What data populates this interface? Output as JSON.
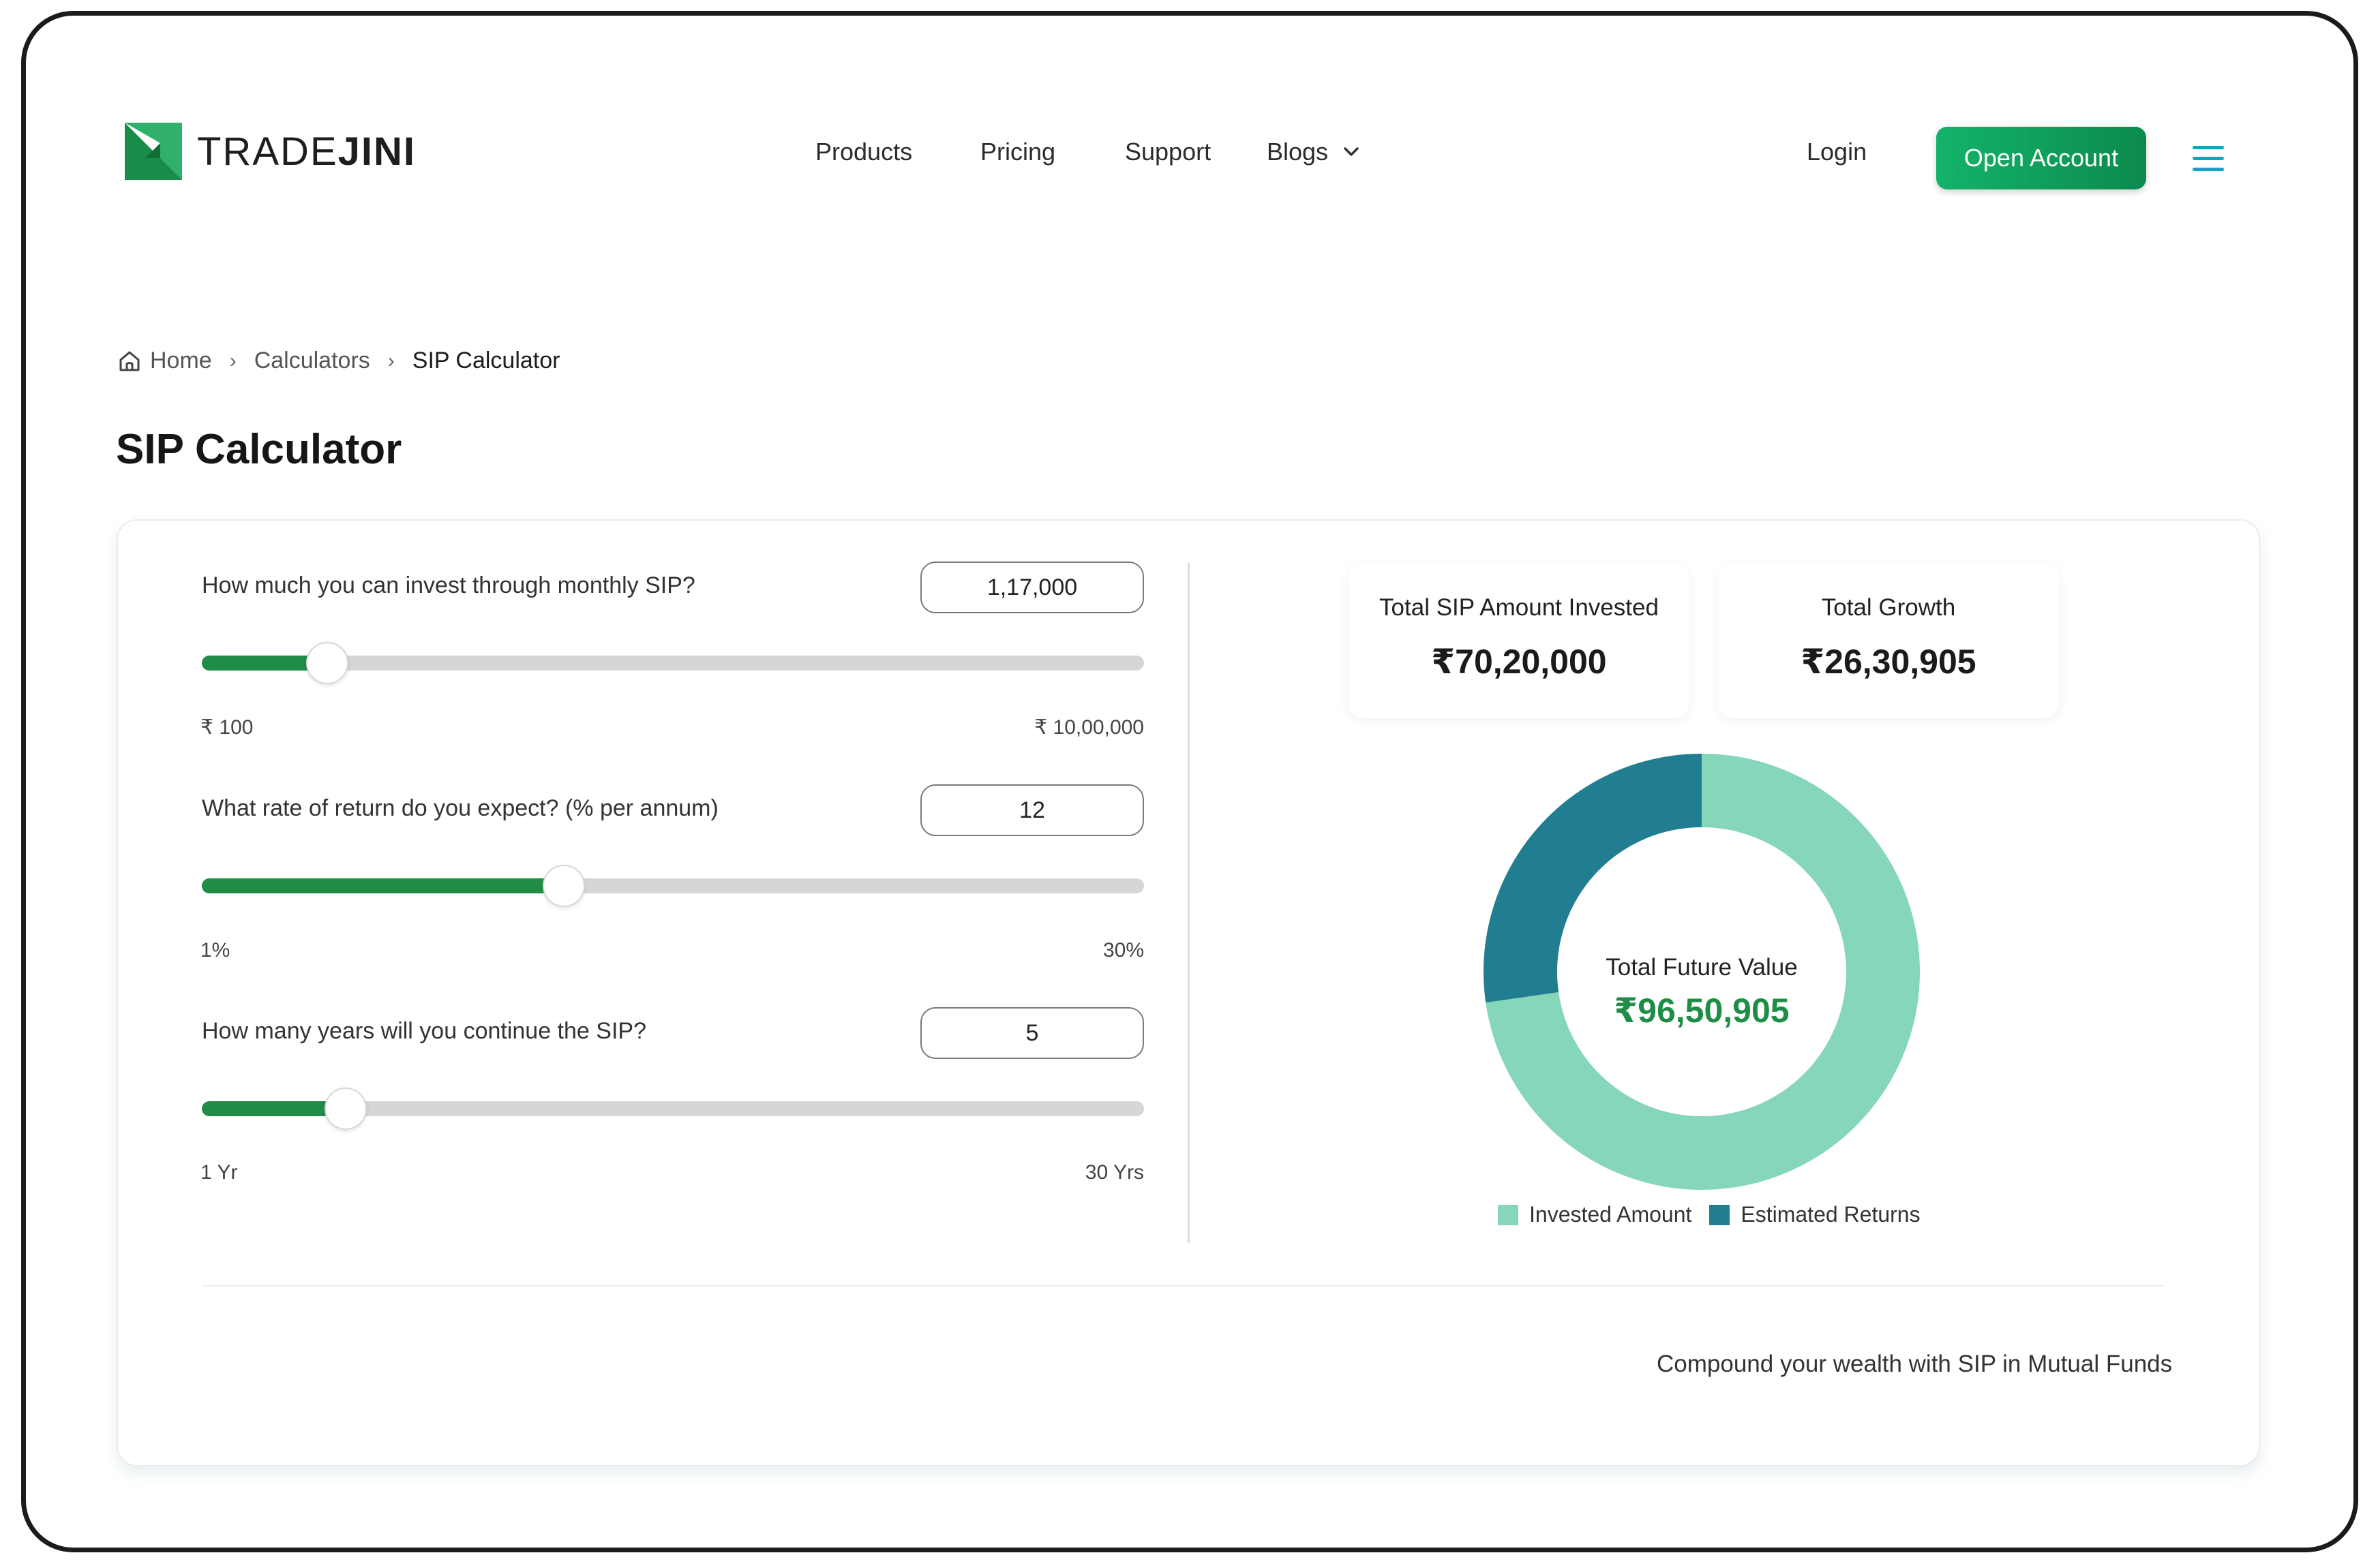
{
  "header": {
    "brand_prefix": "TRADE",
    "brand_suffix": "JINI",
    "nav": [
      "Products",
      "Pricing",
      "Support"
    ],
    "blogs_label": "Blogs",
    "login_label": "Login",
    "open_account_label": "Open Account"
  },
  "breadcrumb": {
    "home": "Home",
    "calculators": "Calculators",
    "current": "SIP Calculator"
  },
  "page_title": "SIP Calculator",
  "calculator": {
    "sip": {
      "question": "How much you can invest through monthly SIP?",
      "value": "1,17,000",
      "min_label": "₹ 100",
      "max_label": "₹ 10,00,000",
      "slider_fraction": 0.133
    },
    "rate": {
      "question": "What rate of return do you expect? (% per annum)",
      "value": "12",
      "min_label": "1%",
      "max_label": "30%",
      "slider_fraction": 0.384
    },
    "years": {
      "question": "How many years will you continue the SIP?",
      "value": "5",
      "min_label": "1 Yr",
      "max_label": "30 Yrs",
      "slider_fraction": 0.153
    }
  },
  "summary": {
    "invested_label": "Total SIP Amount Invested",
    "invested_value": "₹70,20,000",
    "growth_label": "Total Growth",
    "growth_value": "₹26,30,905",
    "future_label": "Total Future Value",
    "future_value": "₹96,50,905"
  },
  "donut": {
    "invested": 7020000,
    "returns": 2630905,
    "invested_color": "#86d6b9",
    "returns_color": "#217e91"
  },
  "legend": {
    "invested": "Invested Amount",
    "returns": "Estimated Returns"
  },
  "footer_text": "Compound your wealth with SIP in Mutual Funds",
  "colors": {
    "accent_green": "#1f8d47",
    "button_green": "#13b36a",
    "menu_blue": "#19a1c4"
  }
}
